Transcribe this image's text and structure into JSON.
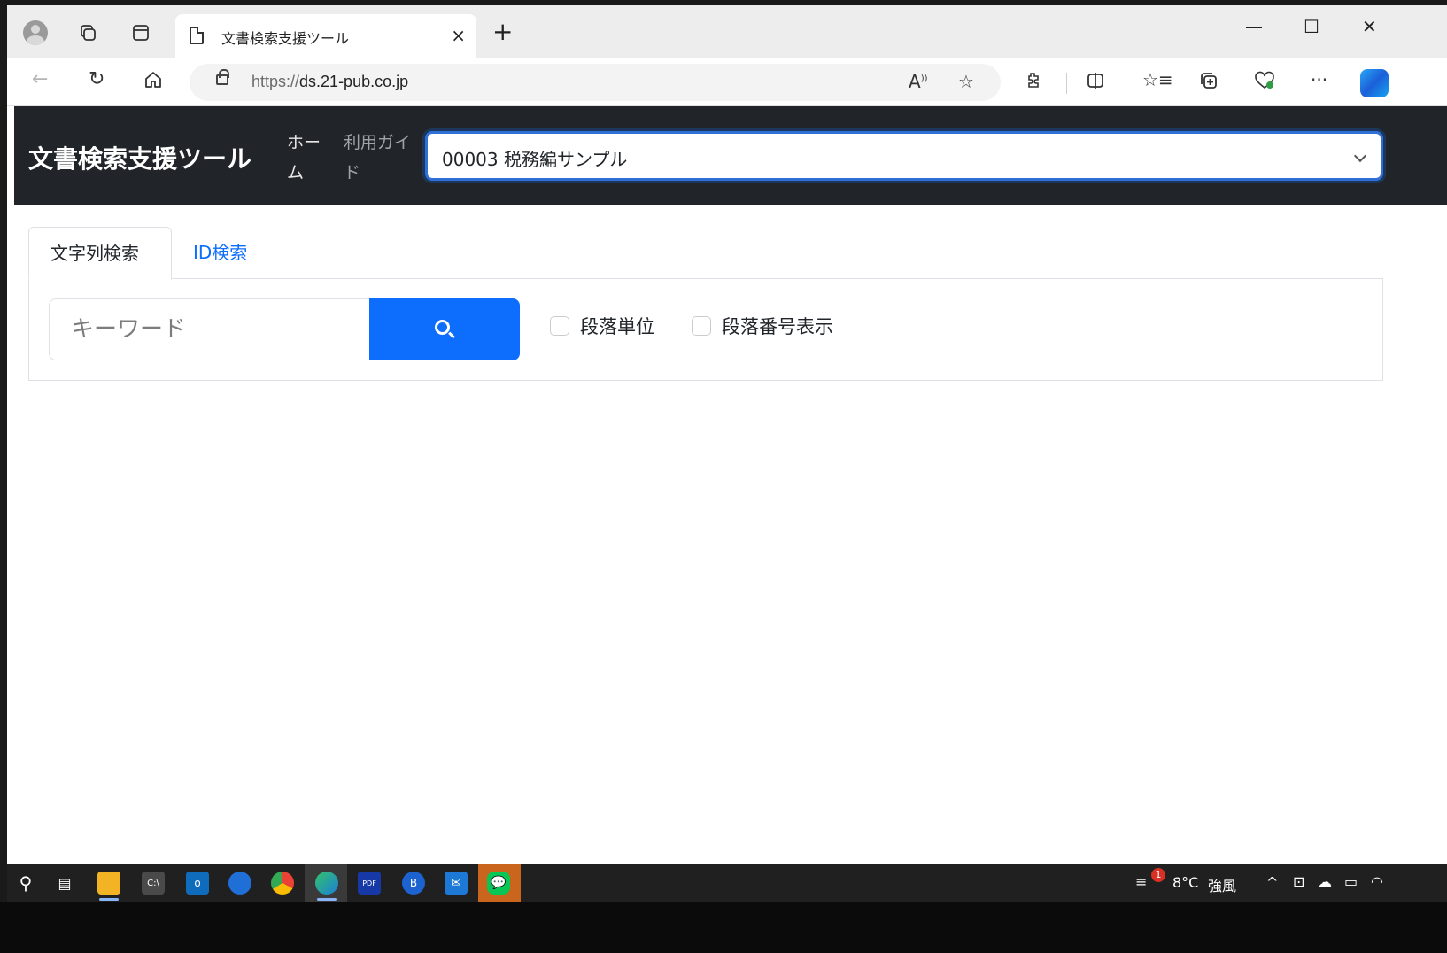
{
  "browser": {
    "tab_title": "文書検索支援ツール",
    "tab_close": "×",
    "new_tab": "+",
    "url_scheme": "https://",
    "url_host": "ds.21-pub.co.jp",
    "window_controls": {
      "minimize": "—",
      "maximize": "☐",
      "close": "✕"
    },
    "icons": [
      "profile-icon",
      "workspaces-icon",
      "tab-actions-icon",
      "back-icon",
      "refresh-icon",
      "home-icon",
      "lock-icon",
      "read-aloud-icon",
      "favorite-icon",
      "extensions-icon",
      "split-screen-icon",
      "favorites-icon",
      "collections-icon",
      "browser-essentials-icon",
      "more-icon",
      "copilot-icon"
    ]
  },
  "site": {
    "brand": "文書検索支援ツール",
    "nav": {
      "home": "ホーム",
      "guide": "利用ガイド"
    },
    "document_select": {
      "value": "00003 税務編サンプル"
    }
  },
  "search": {
    "tabs": [
      {
        "label": "文字列検索",
        "active": true
      },
      {
        "label": "ID検索",
        "active": false
      }
    ],
    "keyword_placeholder": "キーワード",
    "options": [
      {
        "label": "段落単位",
        "checked": false
      },
      {
        "label": "段落番号表示",
        "checked": false
      }
    ]
  },
  "taskbar": {
    "weather_badge": "1",
    "temperature": "8°C",
    "weather_text": "強風",
    "tray_chevron": "^",
    "colors": {
      "primary": "#0d6efd",
      "header": "#212529"
    }
  }
}
